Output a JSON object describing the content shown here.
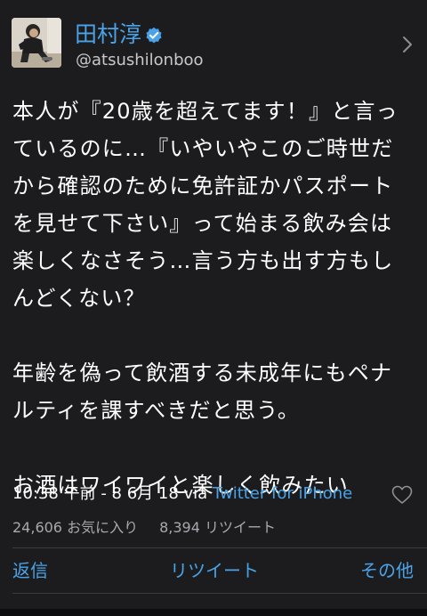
{
  "user": {
    "display_name": "田村淳",
    "handle": "@atsushilonboo",
    "verified": true,
    "verified_icon": "verified-badge-icon",
    "avatar_icon": "avatar-photo"
  },
  "tweet": {
    "paragraphs": [
      [
        "本人が『20歳を超えてます！』と言っ",
        "ているのに…『いやいやこのご時世だ",
        "から確認のために免許証かパスポート",
        "を見せて下さい』って始まる飲み会は",
        "楽しくなさそう…言う方も出す方もし",
        "んどくない？"
      ],
      [
        "年齢を偽って飲酒する未成年にもペナ",
        "ルティを課すべきだと思う。"
      ],
      [
        "お酒はワイワイと楽しく飲みたい"
      ]
    ],
    "timestamp": "10:38 午前 - 8 6月 18",
    "via_label": "via",
    "client": "Twitter for iPhone",
    "favorite_icon": "heart-icon"
  },
  "stats": {
    "favorites": "24,606 お気に入り",
    "retweets": "8,394 リツイート"
  },
  "actions": {
    "reply": "返信",
    "retweet": "リツイート",
    "more": "その他"
  },
  "colors": {
    "background": "#1c1c1e",
    "accent": "#4aa3e8",
    "text": "#ffffff",
    "secondary": "#a8a8ae"
  }
}
